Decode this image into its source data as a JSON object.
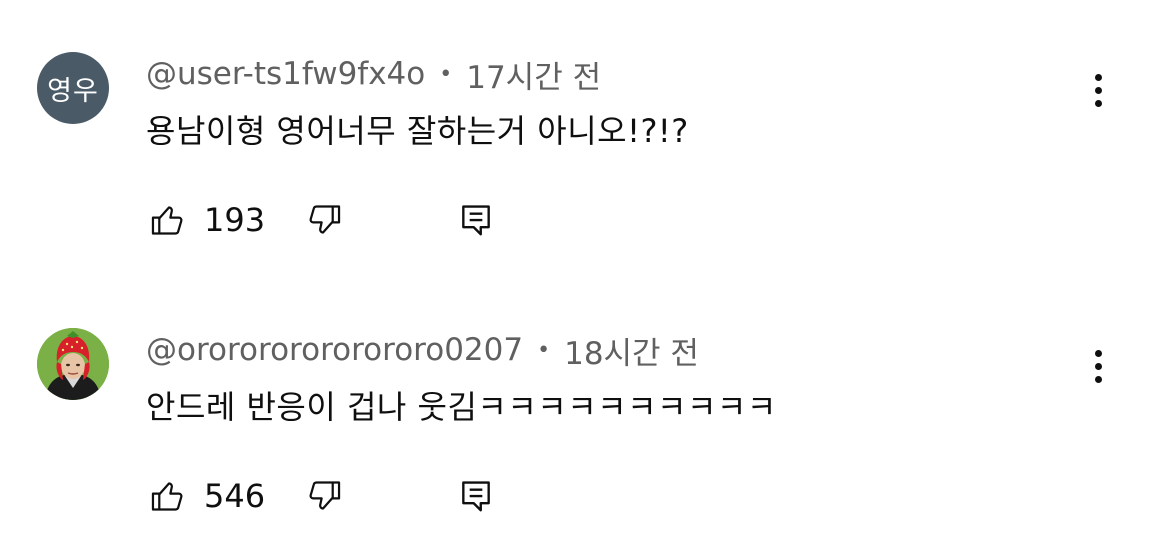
{
  "comments": [
    {
      "author": "@user-ts1fw9fx4o",
      "time": "17시간 전",
      "avatar_text": "영우",
      "text": "용남이형 영어너무 잘하는거 아니오!?!?",
      "likes": "193"
    },
    {
      "author": "@ororororororororo0207",
      "time": "18시간 전",
      "text": "안드레 반응이 겁나 웃김ㅋㅋㅋㅋㅋㅋㅋㅋㅋㅋ",
      "likes": "546"
    }
  ],
  "separator": "•",
  "icons": {
    "like": "thumbs-up-icon",
    "dislike": "thumbs-down-icon",
    "reply": "comment-reply-icon",
    "menu": "more-vertical-icon"
  },
  "colors": {
    "avatar_bg": "#4a5a67",
    "meta_text": "#606060",
    "body_text": "#0f0f0f"
  }
}
